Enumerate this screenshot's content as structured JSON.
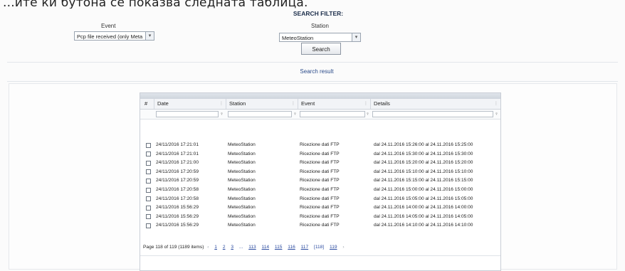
{
  "top_text": "...ите ки бутона се показва следната таблица.",
  "filter": {
    "title": "SEARCH FILTER:",
    "event_label": "Event",
    "event_value": "Pcp file received (only Meta",
    "station_label": "Station",
    "station_value": "MeteoStation",
    "search_button": "Search"
  },
  "result_title": "Search result",
  "grid": {
    "columns": [
      "#",
      "Date",
      "Station",
      "Event",
      "Details"
    ],
    "rows": [
      {
        "date": "24/11/2016 17:21:01",
        "station": "MeteoStation",
        "event": "Ricezione dati FTP",
        "details": "dal 24.11.2016 15:26:00 al 24.11.2016 15:25:00"
      },
      {
        "date": "24/11/2016 17:21:01",
        "station": "MeteoStation",
        "event": "Ricezione dati FTP",
        "details": "dal 24.11.2016 15:30:00 al 24.11.2016 15:30:00"
      },
      {
        "date": "24/11/2016 17:21:00",
        "station": "MeteoStation",
        "event": "Ricezione dati FTP",
        "details": "dal 24.11.2016 15:20:00 al 24.11.2016 15:20:00"
      },
      {
        "date": "24/11/2016 17:20:59",
        "station": "MeteoStation",
        "event": "Ricezione dati FTP",
        "details": "dal 24.11.2016 15:10:00 al 24.11.2016 15:10:00"
      },
      {
        "date": "24/11/2016 17:20:59",
        "station": "MeteoStation",
        "event": "Ricezione dati FTP",
        "details": "dal 24.11.2016 15:15:00 al 24.11.2016 15:15:00"
      },
      {
        "date": "24/11/2016 17:20:58",
        "station": "MeteoStation",
        "event": "Ricezione dati FTP",
        "details": "dal 24.11.2016 15:00:00 al 24.11.2016 15:00:00"
      },
      {
        "date": "24/11/2016 17:20:58",
        "station": "MeteoStation",
        "event": "Ricezione dati FTP",
        "details": "dal 24.11.2016 15:05:00 al 24.11.2016 15:05:00"
      },
      {
        "date": "24/11/2016 15:56:29",
        "station": "MeteoStation",
        "event": "Ricezione dati FTP",
        "details": "dal 24.11.2016 14:00:00 al 24.11.2016 14:00:00"
      },
      {
        "date": "24/11/2016 15:56:29",
        "station": "MeteoStation",
        "event": "Ricezione dati FTP",
        "details": "dal 24.11.2016 14:05:00 al 24.11.2016 14:05:00"
      },
      {
        "date": "24/11/2016 15:56:29",
        "station": "MeteoStation",
        "event": "Ricezione dati FTP",
        "details": "dal 24.11.2016 14:10:00 al 24.11.2016 14:10:00"
      }
    ],
    "pager": {
      "summary": "Page 118 of 119 (1189 items)",
      "prev": "‹",
      "first_pages": [
        "1",
        "2",
        "3"
      ],
      "ellipsis": "...",
      "pages": [
        "113",
        "114",
        "115",
        "116",
        "117"
      ],
      "current": "[118]",
      "last": "119",
      "next": "›"
    }
  }
}
